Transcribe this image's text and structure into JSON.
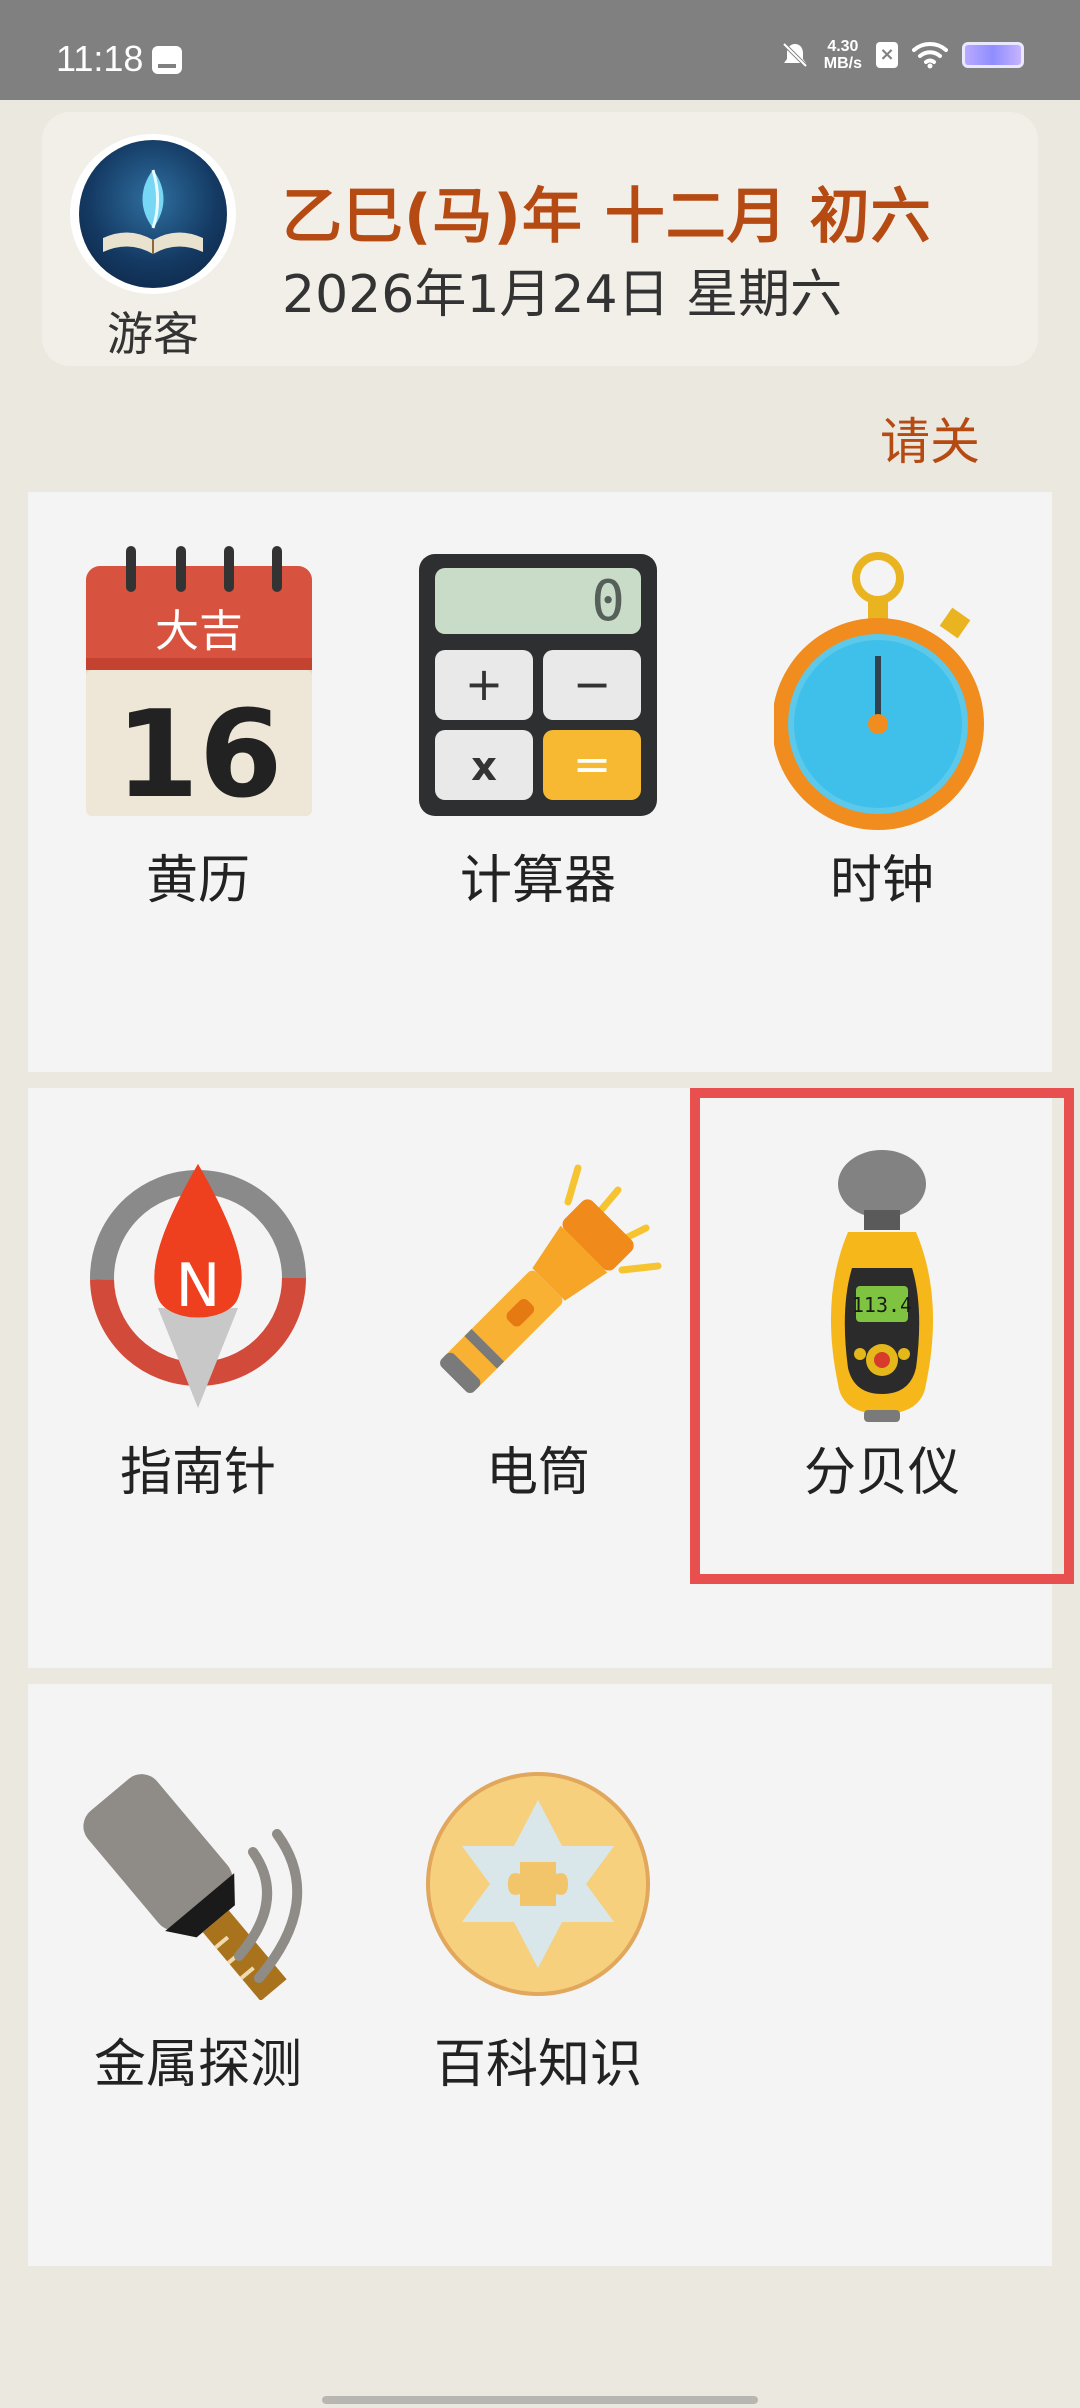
{
  "status_bar": {
    "time": "11:18",
    "net_speed_value": "4.30",
    "net_speed_unit": "MB/s",
    "icons": [
      "message-icon",
      "mute-icon",
      "sim-icon",
      "wifi-icon",
      "battery-icon"
    ]
  },
  "header": {
    "user_name": "游客",
    "lunar_date": "乙巳(马)年 十二月 初六",
    "solar_date": "2026年1月24日 星期六"
  },
  "marquee_text": "请关",
  "tools": [
    {
      "label": "黄历",
      "icon": "calendar-icon",
      "icon_text_top": "大吉",
      "icon_text_main": "16"
    },
    {
      "label": "计算器",
      "icon": "calculator-icon",
      "display": "0",
      "keys": [
        "+",
        "−",
        "x",
        "="
      ]
    },
    {
      "label": "时钟",
      "icon": "stopwatch-icon"
    },
    {
      "label": "指南针",
      "icon": "compass-icon",
      "icon_text": "N"
    },
    {
      "label": "电筒",
      "icon": "flashlight-icon"
    },
    {
      "label": "分贝仪",
      "icon": "decibel-meter-icon",
      "display": "113.4"
    },
    {
      "label": "金属探测",
      "icon": "metal-detector-icon"
    },
    {
      "label": "百科知识",
      "icon": "encyclopedia-icon"
    }
  ],
  "colors": {
    "accent": "#b64a13",
    "highlight_box": "#e7504e",
    "background": "#ebe8df",
    "panel": "#f4f4f4"
  }
}
